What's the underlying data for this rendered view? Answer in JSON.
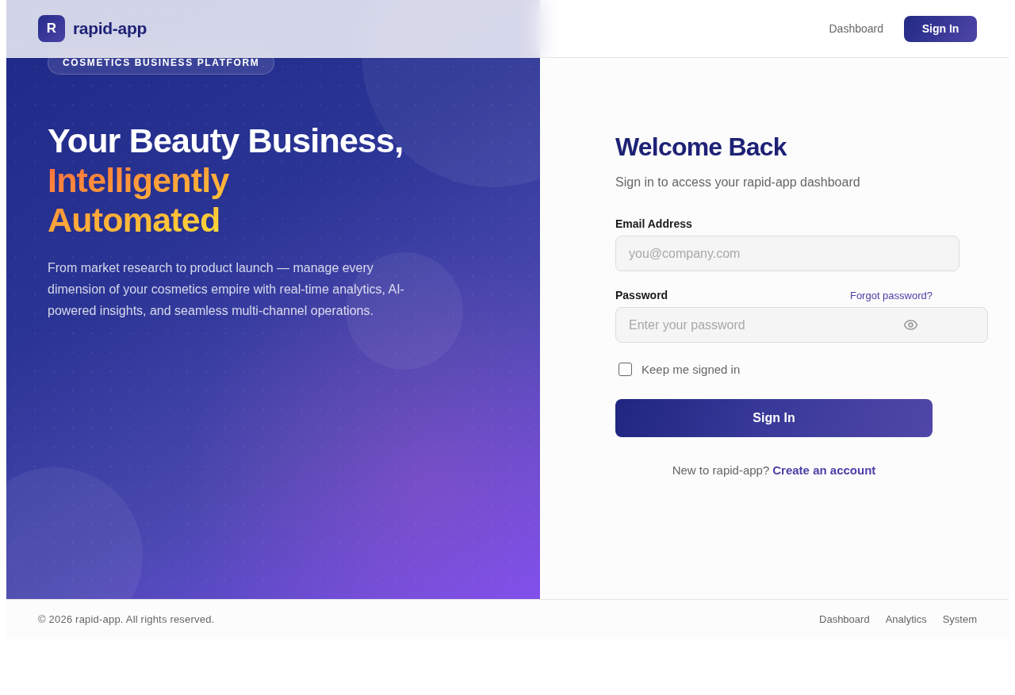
{
  "header": {
    "logo_letter": "R",
    "brand": "rapid-app",
    "nav": [
      {
        "label": "Dashboard"
      }
    ],
    "cta": "Sign In"
  },
  "hero": {
    "badge": "COSMETICS BUSINESS PLATFORM",
    "headline": "Your Beauty Business,",
    "highlight_lines": [
      "Intelligently",
      "Automated"
    ],
    "description": "From market research to product launch — manage every dimension of your cosmetics empire with real-time analytics, AI-powered insights, and seamless multi-channel operations."
  },
  "form": {
    "title": "Welcome Back",
    "subtitle": "Sign in to access your rapid-app dashboard",
    "fields": [
      {
        "kind": "email",
        "label": "Email Address",
        "placeholder": "you@company.com"
      },
      {
        "kind": "password",
        "label": "Password",
        "link": "Forgot password?",
        "placeholder": "Enter your password"
      }
    ],
    "remember": {
      "label": "Keep me signed in",
      "checked": false
    },
    "submit": "Sign In",
    "signup_prompt": "New to rapid-app?",
    "signup_link": "Create an account"
  },
  "footer": {
    "copyright": "© 2026 rapid-app. All rights reserved.",
    "links": [
      "Dashboard",
      "Analytics",
      "System"
    ]
  }
}
